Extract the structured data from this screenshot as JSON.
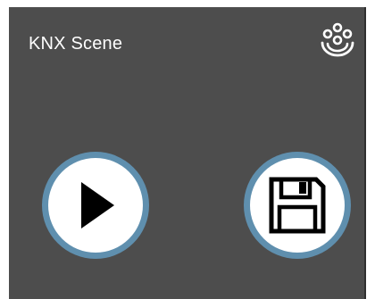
{
  "header": {
    "title": "KNX Scene",
    "scene_icon": "knx-scene-icon"
  },
  "actions": {
    "play_icon": "play-icon",
    "save_icon": "floppy-disk-save-icon"
  },
  "colors": {
    "panel_background": "#4d4d4d",
    "button_ring": "#5f8fae",
    "button_face": "#ffffff",
    "icon": "#000000",
    "title_text": "#ffffff"
  }
}
